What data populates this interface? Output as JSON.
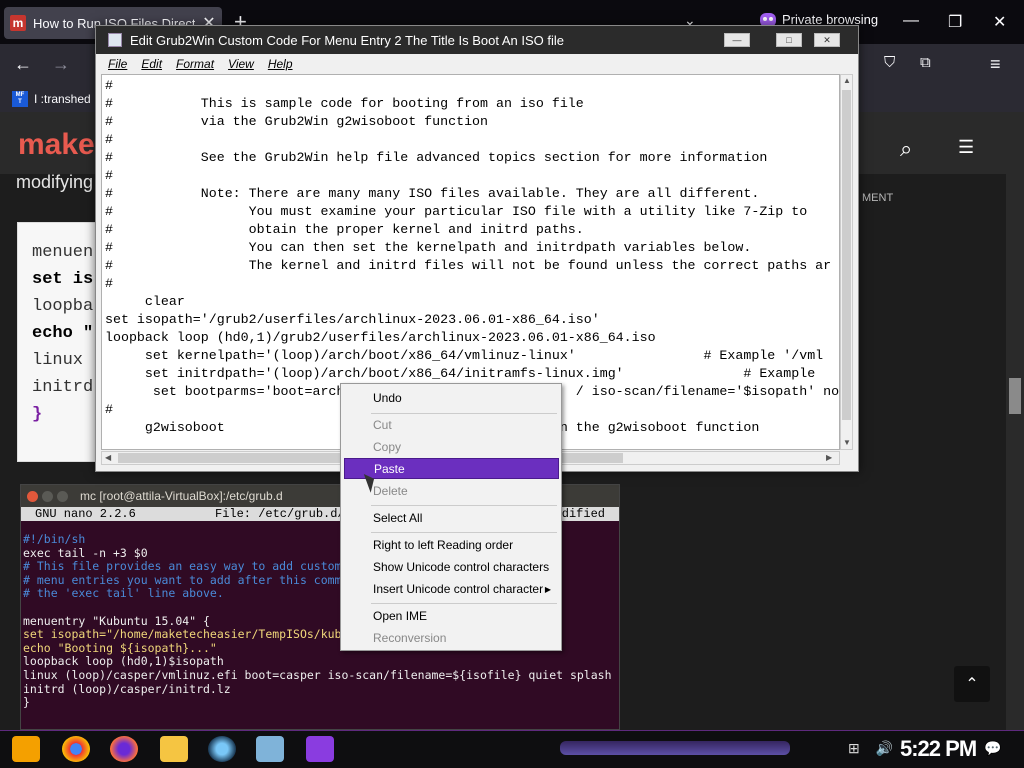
{
  "browser": {
    "tab_title": "How to Run ISO Files Directl",
    "tab_favicon": "m",
    "tab_close": "✕",
    "new_tab": "+",
    "tab_dropdown": "⌄",
    "private_label": "Private browsing",
    "win_minimize": "—",
    "win_restore": "❐",
    "win_close": "✕",
    "bookmark_label": "I :transhed"
  },
  "site": {
    "logo": "make",
    "intro_partial": "modifying",
    "code_lines": [
      "menuen",
      "set is",
      "loopba",
      "echo \"",
      "linux",
      "initrd",
      "}"
    ],
    "comments_label": "MENT"
  },
  "editor": {
    "window_title": "Edit Grub2Win Custom Code For Menu Entry 2        The Title Is Boot An ISO file",
    "btn_min": "—",
    "btn_max": "□",
    "btn_close": "✕",
    "menus": [
      "File",
      "Edit",
      "Format",
      "View",
      "Help"
    ],
    "lines": [
      "#",
      "#           This is sample code for booting from an iso file",
      "#           via the Grub2Win g2wisoboot function",
      "#",
      "#           See the Grub2Win help file advanced topics section for more information",
      "#",
      "#           Note: There are many many ISO files available. They are all different.",
      "#                 You must examine your particular ISO file with a utility like 7-Zip to",
      "#                 obtain the proper kernel and initrd paths.",
      "#                 You can then set the kernelpath and initrdpath variables below.",
      "#                 The kernel and initrd files will not be found unless the correct paths ar",
      "#",
      "     clear",
      "set isopath='/grub2/userfiles/archlinux-2023.06.01-x86_64.iso'",
      "loopback loop (hd0,1)/grub2/userfiles/archlinux-2023.06.01-x86_64.iso",
      "     set kernelpath='(loop)/arch/boot/x86_64/vmlinuz-linux'                # Example '/vml",
      "     set initrdpath='(loop)/arch/boot/x86_64/initramfs-linux.img'               # Example",
      "      set bootparms='boot=arch                             / iso-scan/filename='$isopath' nopu",
      "#",
      "     g2wisoboot                                      # Run the g2wisoboot function"
    ]
  },
  "context_menu": {
    "undo": "Undo",
    "cut": "Cut",
    "copy": "Copy",
    "paste": "Paste",
    "delete": "Delete",
    "select_all": "Select All",
    "rtl": "Right to left Reading order",
    "show_unicode": "Show Unicode control characters",
    "insert_unicode": "Insert Unicode control character",
    "open_ime": "Open IME",
    "reconversion": "Reconversion"
  },
  "terminal": {
    "title": "mc [root@attila-VirtualBox]:/etc/grub.d",
    "nano_version": "GNU nano 2.2.6",
    "nano_file": "File: /etc/grub.d/4",
    "nano_modified": "dified",
    "lines": [
      "#!/bin/sh",
      "exec tail -n +3 $0",
      "# This file provides an easy way to add custom",
      "# menu entries you want to add after this comme",
      "# the 'exec tail' line above.",
      "",
      "menuentry \"Kubuntu 15.04\" {",
      "set isopath=\"/home/maketecheasier/TempISOs/kubu",
      "echo \"Booting ${isopath}...\"",
      "loopback loop (hd0,1)$isopath",
      "linux (loop)/casper/vmlinuz.efi boot=casper iso-scan/filename=${isofile} quiet splash",
      "initrd (loop)/casper/initrd.lz",
      "}"
    ]
  },
  "taskbar": {
    "clock": "5:22 PM",
    "tray": "⊞ 🔊"
  },
  "colors": {
    "accent_purple": "#6b2fbf",
    "brand_red": "#e85a4f",
    "terminal_bg": "#300a24"
  }
}
